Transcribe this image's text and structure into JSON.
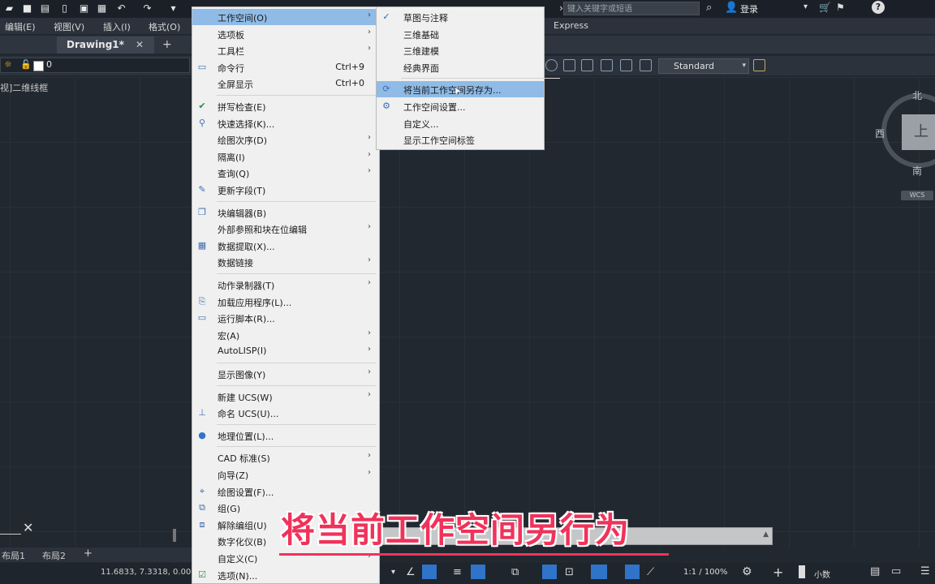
{
  "titlebar": {
    "search_placeholder": "键入关键字或短语",
    "login_label": "登录"
  },
  "menubar": {
    "items": [
      "编辑(E)",
      "视图(V)",
      "插入(I)",
      "格式(O)"
    ],
    "express": "Express"
  },
  "doc_tab": {
    "label": "Drawing1*",
    "close": "✕",
    "add": "+"
  },
  "layer": {
    "name": "0"
  },
  "text_style": {
    "value": "Standard"
  },
  "viewport": {
    "label": "视]二维线框"
  },
  "viewcube": {
    "north": "北",
    "south": "南",
    "west": "西",
    "top": "上",
    "wcs": "WCS"
  },
  "layouts": {
    "tab1": "布局1",
    "tab2": "布局2",
    "add": "+"
  },
  "status": {
    "coords": "11.6833, 7.3318, 0.000",
    "scale": "1:1 / 100%",
    "units": "小数"
  },
  "menu_main": [
    {
      "label": "工作空间(O)",
      "shortcut": "",
      "submenu": true,
      "icon": "",
      "highlight": true
    },
    {
      "label": "选项板",
      "shortcut": "",
      "submenu": true,
      "icon": ""
    },
    {
      "label": "工具栏",
      "shortcut": "",
      "submenu": true,
      "icon": ""
    },
    {
      "label": "命令行",
      "shortcut": "Ctrl+9",
      "submenu": false,
      "icon": "command-line-icon"
    },
    {
      "label": "全屏显示",
      "shortcut": "Ctrl+0",
      "submenu": false,
      "icon": ""
    },
    {
      "sep": true
    },
    {
      "label": "拼写检查(E)",
      "shortcut": "",
      "submenu": false,
      "icon": "spellcheck-icon"
    },
    {
      "label": "快速选择(K)...",
      "shortcut": "",
      "submenu": false,
      "icon": "quick-select-icon"
    },
    {
      "label": "绘图次序(D)",
      "shortcut": "",
      "submenu": true,
      "icon": ""
    },
    {
      "label": "隔离(I)",
      "shortcut": "",
      "submenu": true,
      "icon": ""
    },
    {
      "label": "查询(Q)",
      "shortcut": "",
      "submenu": true,
      "icon": ""
    },
    {
      "label": "更新字段(T)",
      "shortcut": "",
      "submenu": false,
      "icon": "update-field-icon"
    },
    {
      "sep": true
    },
    {
      "label": "块编辑器(B)",
      "shortcut": "",
      "submenu": false,
      "icon": "block-editor-icon"
    },
    {
      "label": "外部参照和块在位编辑",
      "shortcut": "",
      "submenu": true,
      "icon": ""
    },
    {
      "label": "数据提取(X)...",
      "shortcut": "",
      "submenu": false,
      "icon": "data-extract-icon"
    },
    {
      "label": "数据链接",
      "shortcut": "",
      "submenu": true,
      "icon": ""
    },
    {
      "sep": true
    },
    {
      "label": "动作录制器(T)",
      "shortcut": "",
      "submenu": true,
      "icon": ""
    },
    {
      "label": "加载应用程序(L)...",
      "shortcut": "",
      "submenu": false,
      "icon": "load-app-icon"
    },
    {
      "label": "运行脚本(R)...",
      "shortcut": "",
      "submenu": false,
      "icon": "script-icon"
    },
    {
      "label": "宏(A)",
      "shortcut": "",
      "submenu": true,
      "icon": ""
    },
    {
      "label": "AutoLISP(I)",
      "shortcut": "",
      "submenu": true,
      "icon": ""
    },
    {
      "sep": true
    },
    {
      "label": "显示图像(Y)",
      "shortcut": "",
      "submenu": true,
      "icon": ""
    },
    {
      "sep": true
    },
    {
      "label": "新建 UCS(W)",
      "shortcut": "",
      "submenu": true,
      "icon": ""
    },
    {
      "label": "命名 UCS(U)...",
      "shortcut": "",
      "submenu": false,
      "icon": "named-ucs-icon"
    },
    {
      "sep": true
    },
    {
      "label": "地理位置(L)...",
      "shortcut": "",
      "submenu": false,
      "icon": "globe-icon"
    },
    {
      "sep": true
    },
    {
      "label": "CAD 标准(S)",
      "shortcut": "",
      "submenu": true,
      "icon": ""
    },
    {
      "label": "向导(Z)",
      "shortcut": "",
      "submenu": true,
      "icon": ""
    },
    {
      "label": "绘图设置(F)...",
      "shortcut": "",
      "submenu": false,
      "icon": "drafting-settings-icon"
    },
    {
      "label": "组(G)",
      "shortcut": "",
      "submenu": false,
      "icon": "group-icon"
    },
    {
      "label": "解除编组(U)",
      "shortcut": "",
      "submenu": false,
      "icon": "ungroup-icon"
    },
    {
      "label": "数字化仪(B)",
      "shortcut": "",
      "submenu": true,
      "icon": ""
    },
    {
      "label": "自定义(C)",
      "shortcut": "",
      "submenu": true,
      "icon": ""
    },
    {
      "label": "选项(N)...",
      "shortcut": "",
      "submenu": false,
      "icon": "options-icon"
    }
  ],
  "menu_sub": [
    {
      "label": "草图与注释",
      "checked": true
    },
    {
      "label": "三维基础"
    },
    {
      "label": "三维建模"
    },
    {
      "label": "经典界面"
    },
    {
      "sep": true
    },
    {
      "label": "将当前工作空间另存为...",
      "highlight": true,
      "icon": "save-workspace-icon"
    },
    {
      "label": "工作空间设置...",
      "icon": "gear-icon"
    },
    {
      "label": "自定义..."
    },
    {
      "label": "显示工作空间标签"
    }
  ],
  "subtitle": "将当前工作空间另行为",
  "colors": {
    "menu_highlight": "#8fbbe6",
    "subtitle": "#f0325a",
    "canvas": "#212830"
  }
}
